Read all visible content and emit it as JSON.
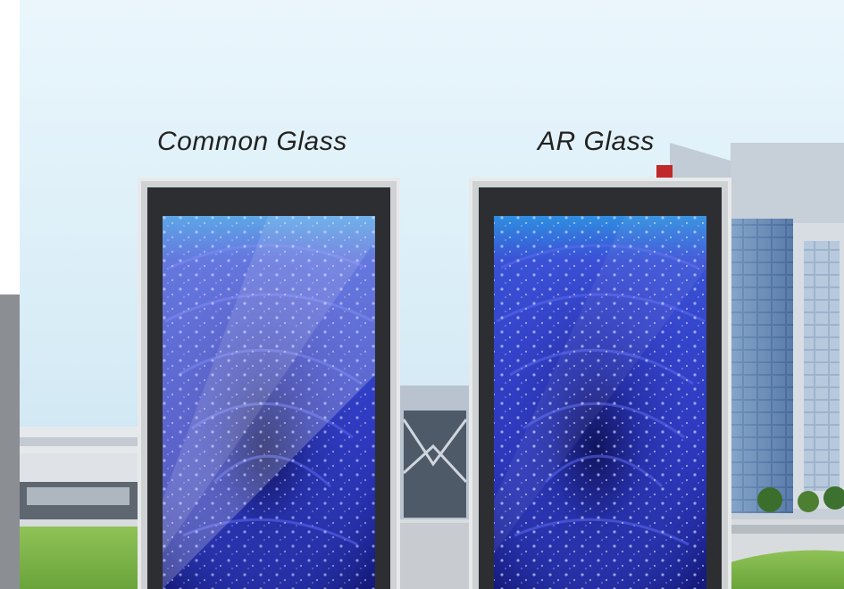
{
  "labels": {
    "common": "Common Glass",
    "ar": "AR Glass"
  },
  "colors": {
    "sky_top": "#e7f4fb",
    "sky_bottom": "#cfe6f3",
    "grass": "#7fb84a",
    "rose_dark": "#1b1f8a",
    "rose_mid": "#3a45d8",
    "rose_light": "#6f7dff",
    "bezel": "#2e2f33",
    "frame": "#e9eaeb"
  }
}
